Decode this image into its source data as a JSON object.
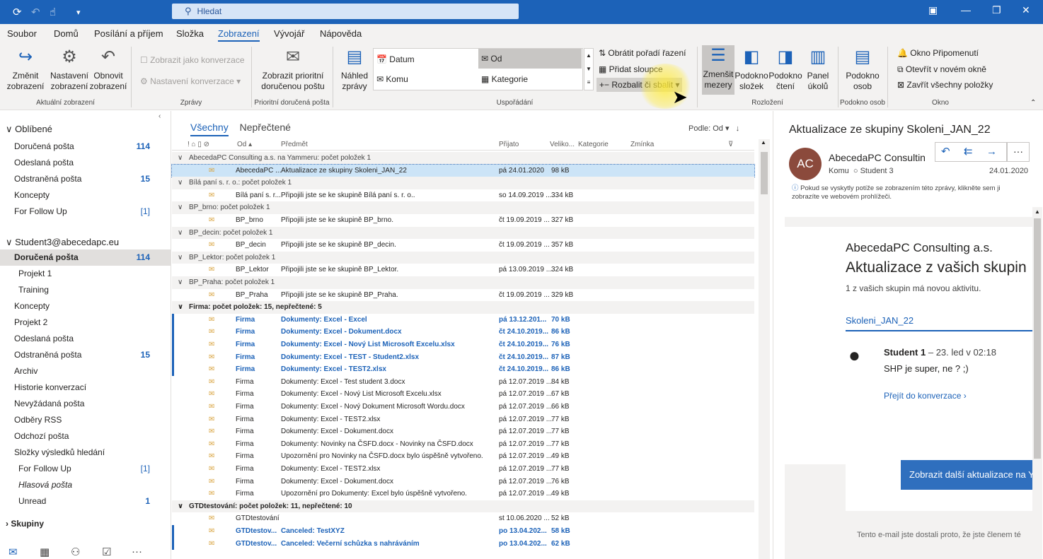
{
  "titlebar": {
    "search_placeholder": "Hledat"
  },
  "menu": [
    "Soubor",
    "Domů",
    "Posílání a příjem",
    "Složka",
    "Zobrazení",
    "Vývojář",
    "Nápověda"
  ],
  "ribbon": {
    "zmenit": "Změnit zobrazení",
    "nastaveni": "Nastavení zobrazení",
    "obnovit": "Obnovit zobrazení",
    "konverzace": "Zobrazit jako konverzace",
    "nast_konv": "Nastavení konverzace",
    "prioritni": "Zobrazit prioritní doručenou poštu",
    "nahled": "Náhled zprávy",
    "arr": [
      "Datum",
      "Komu",
      "Od",
      "Kategorie"
    ],
    "obratit": "Obrátit pořadí řazení",
    "pridat": "Přidat sloupce",
    "rozbalit": "Rozbalit či sbalit",
    "zmensit": "Zmenšit mezery",
    "pslozek": "Podokno složek",
    "pcteni": "Podokno čtení",
    "pukolu": "Panel úkolů",
    "posob": "Podokno osob",
    "okno1": "Okno Připomenutí",
    "okno2": "Otevřít v novém okně",
    "okno3": "Zavřít všechny položky",
    "groups": [
      "Aktuální zobrazení",
      "Zprávy",
      "Prioritní doručená pošta",
      "Uspořádání",
      "Rozložení",
      "Podokno osob",
      "Okno"
    ]
  },
  "folders": {
    "fav": "Oblíbené",
    "favitems": [
      {
        "l": "Doručená pošta",
        "c": "114"
      },
      {
        "l": "Odeslaná pošta",
        "c": ""
      },
      {
        "l": "Odstraněná pošta",
        "c": "15"
      },
      {
        "l": "Koncepty",
        "c": ""
      },
      {
        "l": "For Follow Up",
        "c": "[1]"
      }
    ],
    "account": "Student3@abecedapc.eu",
    "items": [
      {
        "l": "Doručená pošta",
        "c": "114"
      },
      {
        "l": "Projekt 1",
        "c": ""
      },
      {
        "l": "Training",
        "c": ""
      },
      {
        "l": "Koncepty",
        "c": ""
      },
      {
        "l": "Projekt 2",
        "c": ""
      },
      {
        "l": "Odeslaná pošta",
        "c": ""
      },
      {
        "l": "Odstraněná pošta",
        "c": "15"
      },
      {
        "l": "Archiv",
        "c": ""
      },
      {
        "l": "Historie konverzací",
        "c": ""
      },
      {
        "l": "Nevyžádaná pošta",
        "c": ""
      },
      {
        "l": "Odběry RSS",
        "c": ""
      },
      {
        "l": "Odchozí pošta",
        "c": ""
      },
      {
        "l": "Složky výsledků hledání",
        "c": ""
      },
      {
        "l": "For Follow Up",
        "c": "[1]"
      },
      {
        "l": "Hlasová pošta",
        "c": ""
      },
      {
        "l": "Unread",
        "c": "1"
      }
    ],
    "groups": "Skupiny"
  },
  "list": {
    "tab_all": "Všechny",
    "tab_unread": "Nepřečtené",
    "sort": "Podle: Od",
    "cols": [
      "Od",
      "Předmět",
      "Přijato",
      "Veliko...",
      "Kategorie",
      "Zmínka"
    ],
    "rows": [
      {
        "t": "g",
        "s": "AbecedaPC Consulting a.s. na Yammeru: počet položek 1"
      },
      {
        "t": "s",
        "f": "AbecedaPC ...",
        "s": "Aktualizace ze skupiny Skoleni_JAN_22",
        "d": "pá 24.01.2020",
        "z": "98 kB"
      },
      {
        "t": "g",
        "s": "Bílá paní s. r. o.: počet položek 1"
      },
      {
        "t": "m",
        "f": "Bílá paní s. r...",
        "s": "Připojili jste se ke skupině Bílá paní s. r. o..",
        "d": "so 14.09.2019 ...",
        "z": "334 kB"
      },
      {
        "t": "g",
        "s": "BP_brno: počet položek 1"
      },
      {
        "t": "m",
        "f": "BP_brno",
        "s": "Připojili jste se ke skupině BP_brno.",
        "d": "čt 19.09.2019 ...",
        "z": "327 kB"
      },
      {
        "t": "g",
        "s": "BP_decin: počet položek 1"
      },
      {
        "t": "m",
        "f": "BP_decin",
        "s": "Připojili jste se ke skupině BP_decin.",
        "d": "čt 19.09.2019 ...",
        "z": "357 kB"
      },
      {
        "t": "g",
        "s": "BP_Lektor: počet položek 1"
      },
      {
        "t": "m",
        "f": "BP_Lektor",
        "s": "Připojili jste se ke skupině BP_Lektor.",
        "d": "pá 13.09.2019 ...",
        "z": "324 kB"
      },
      {
        "t": "g",
        "s": "BP_Praha: počet položek 1"
      },
      {
        "t": "m",
        "f": "BP_Praha",
        "s": "Připojili jste se ke skupině BP_Praha.",
        "d": "čt 19.09.2019 ...",
        "z": "329 kB"
      },
      {
        "t": "gb",
        "s": "Firma: počet položek: 15, nepřečtené: 5"
      },
      {
        "t": "u",
        "f": "Firma",
        "s": "Dokumenty: Excel - Excel",
        "d": "pá 13.12.201...",
        "z": "70 kB"
      },
      {
        "t": "u",
        "f": "Firma",
        "s": "Dokumenty: Excel - Dokument.docx",
        "d": "čt 24.10.2019...",
        "z": "86 kB"
      },
      {
        "t": "u",
        "f": "Firma",
        "s": "Dokumenty: Excel - Nový List Microsoft Excelu.xlsx",
        "d": "čt 24.10.2019...",
        "z": "76 kB"
      },
      {
        "t": "u",
        "f": "Firma",
        "s": "Dokumenty: Excel - TEST - Student2.xlsx",
        "d": "čt 24.10.2019...",
        "z": "87 kB"
      },
      {
        "t": "u",
        "f": "Firma",
        "s": "Dokumenty: Excel - TEST2.xlsx",
        "d": "čt 24.10.2019...",
        "z": "86 kB"
      },
      {
        "t": "m",
        "f": "Firma",
        "s": "Dokumenty: Excel - Test student 3.docx",
        "d": "pá 12.07.2019 ...",
        "z": "84 kB"
      },
      {
        "t": "m",
        "f": "Firma",
        "s": "Dokumenty: Excel - Nový List Microsoft Excelu.xlsx",
        "d": "pá 12.07.2019 ...",
        "z": "67 kB"
      },
      {
        "t": "m",
        "f": "Firma",
        "s": "Dokumenty: Excel - Nový Dokument Microsoft Wordu.docx",
        "d": "pá 12.07.2019 ...",
        "z": "66 kB"
      },
      {
        "t": "m",
        "f": "Firma",
        "s": "Dokumenty: Excel - TEST2.xlsx",
        "d": "pá 12.07.2019 ...",
        "z": "77 kB"
      },
      {
        "t": "m",
        "f": "Firma",
        "s": "Dokumenty: Excel - Dokument.docx",
        "d": "pá 12.07.2019 ...",
        "z": "77 kB"
      },
      {
        "t": "m",
        "f": "Firma",
        "s": "Dokumenty: Novinky na ČSFD.docx - Novinky na ČSFD.docx",
        "d": "pá 12.07.2019 ...",
        "z": "77 kB"
      },
      {
        "t": "m",
        "f": "Firma",
        "s": "Upozornění pro Novinky na ČSFD.docx bylo úspěšně vytvořeno.",
        "d": "pá 12.07.2019 ...",
        "z": "49 kB"
      },
      {
        "t": "m",
        "f": "Firma",
        "s": "Dokumenty: Excel - TEST2.xlsx",
        "d": "pá 12.07.2019 ...",
        "z": "77 kB"
      },
      {
        "t": "m",
        "f": "Firma",
        "s": "Dokumenty: Excel - Dokument.docx",
        "d": "pá 12.07.2019 ...",
        "z": "76 kB"
      },
      {
        "t": "m",
        "f": "Firma",
        "s": "Upozornění pro Dokumenty: Excel bylo úspěšně vytvořeno.",
        "d": "pá 12.07.2019 ...",
        "z": "49 kB"
      },
      {
        "t": "gb",
        "s": "GTDtestování: počet položek: 11, nepřečtené: 10"
      },
      {
        "t": "m",
        "f": "GTDtestování",
        "s": "",
        "d": "st 10.06.2020 ...",
        "z": "52 kB"
      },
      {
        "t": "u",
        "f": "GTDtestov...",
        "s": "Canceled: TestXYZ",
        "d": "po 13.04.202...",
        "z": "58 kB"
      },
      {
        "t": "u",
        "f": "GTDtestov...",
        "s": "Canceled: Večerní schůzka s nahráváním",
        "d": "po 13.04.202...",
        "z": "62 kB"
      }
    ]
  },
  "reading": {
    "title": "Aktualizace ze skupiny Skoleni_JAN_22",
    "avatar": "AC",
    "sender": "AbecedaPC Consultin",
    "to_label": "Komu",
    "to": "Student 3",
    "date": "24.01.2020",
    "info": "Pokud se vyskytly potíže se zobrazením této zprávy, klikněte sem ji zobrazíte ve webovém prohlížeči.",
    "company": "AbecedaPC Consulting a.s.",
    "headline": "Aktualizace z vašich skupin",
    "sub": "1 z vašich skupin má novou aktivitu.",
    "group": "Skoleni_JAN_22",
    "post_author": "Student 1",
    "post_meta": "– 23. led v 02:18",
    "post_text": "SHP je super, ne ? ;)",
    "link": "Přejít do konverzace ›",
    "btn": "Zobrazit další aktualizace na Y",
    "footer": "Tento e-mail jste dostali proto, že jste členem té"
  }
}
